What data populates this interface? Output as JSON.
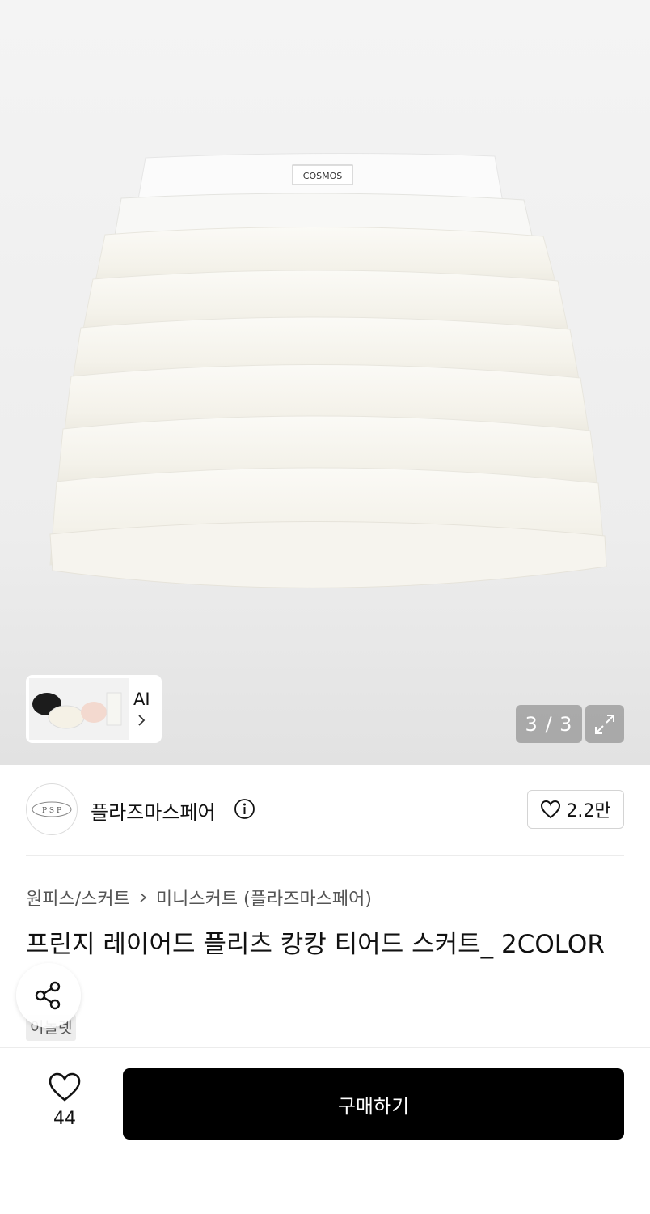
{
  "gallery": {
    "counter": "3 / 3",
    "ai_label": "AI",
    "waistband_brand": "COSMOS"
  },
  "seller": {
    "name": "플라즈마스페어",
    "logo_text": "P S P",
    "like_count": "2.2만"
  },
  "breadcrumb": {
    "category": "원피스/스커트",
    "subcategory": "미니스커트 (플라즈마스페어)"
  },
  "product": {
    "title": "프린지 레이어드 플리츠 캉캉 티어드 스커트_ 2COLOR",
    "badge": "이놀렛"
  },
  "bottom_bar": {
    "wish_count": "44",
    "buy_label": "구매하기"
  },
  "icons": [
    "expand-icon",
    "chevron-right-icon",
    "info-icon",
    "heart-icon",
    "share-icon",
    "brand-logo"
  ],
  "colors": {
    "accent": "#000000",
    "hero_bg": "#efefef",
    "counter_bg": "#969696"
  }
}
